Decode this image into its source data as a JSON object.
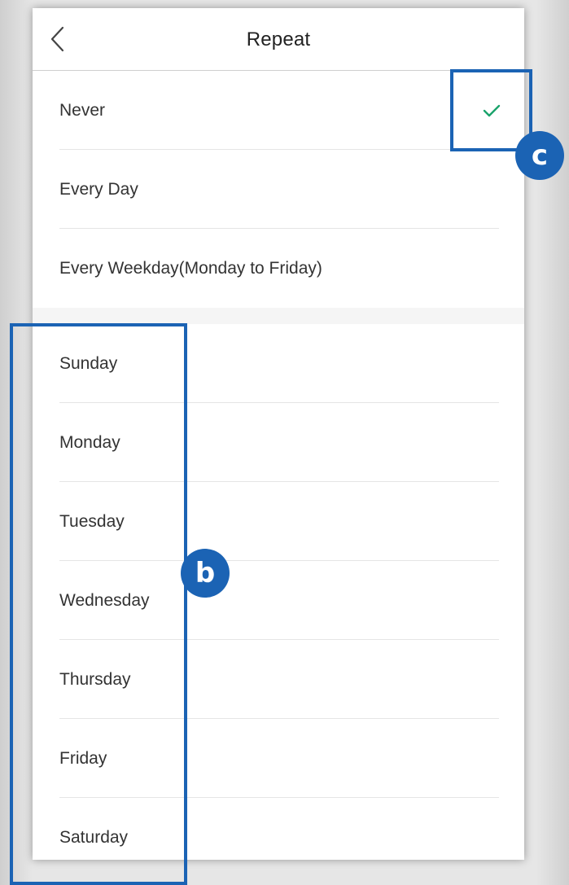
{
  "header": {
    "title": "Repeat"
  },
  "options_group1": [
    {
      "label": "Never",
      "selected": true
    },
    {
      "label": "Every Day",
      "selected": false
    },
    {
      "label": "Every Weekday(Monday to Friday)",
      "selected": false
    }
  ],
  "options_days": [
    {
      "label": "Sunday"
    },
    {
      "label": "Monday"
    },
    {
      "label": "Tuesday"
    },
    {
      "label": "Wednesday"
    },
    {
      "label": "Thursday"
    },
    {
      "label": "Friday"
    },
    {
      "label": "Saturday"
    }
  ],
  "annotations": {
    "badge_b": "b",
    "badge_c": "c"
  },
  "colors": {
    "accent_check": "#1aa36b",
    "annotation_blue": "#1b63b4"
  },
  "icons": {
    "back": "chevron-left-icon",
    "selected": "checkmark-icon"
  }
}
